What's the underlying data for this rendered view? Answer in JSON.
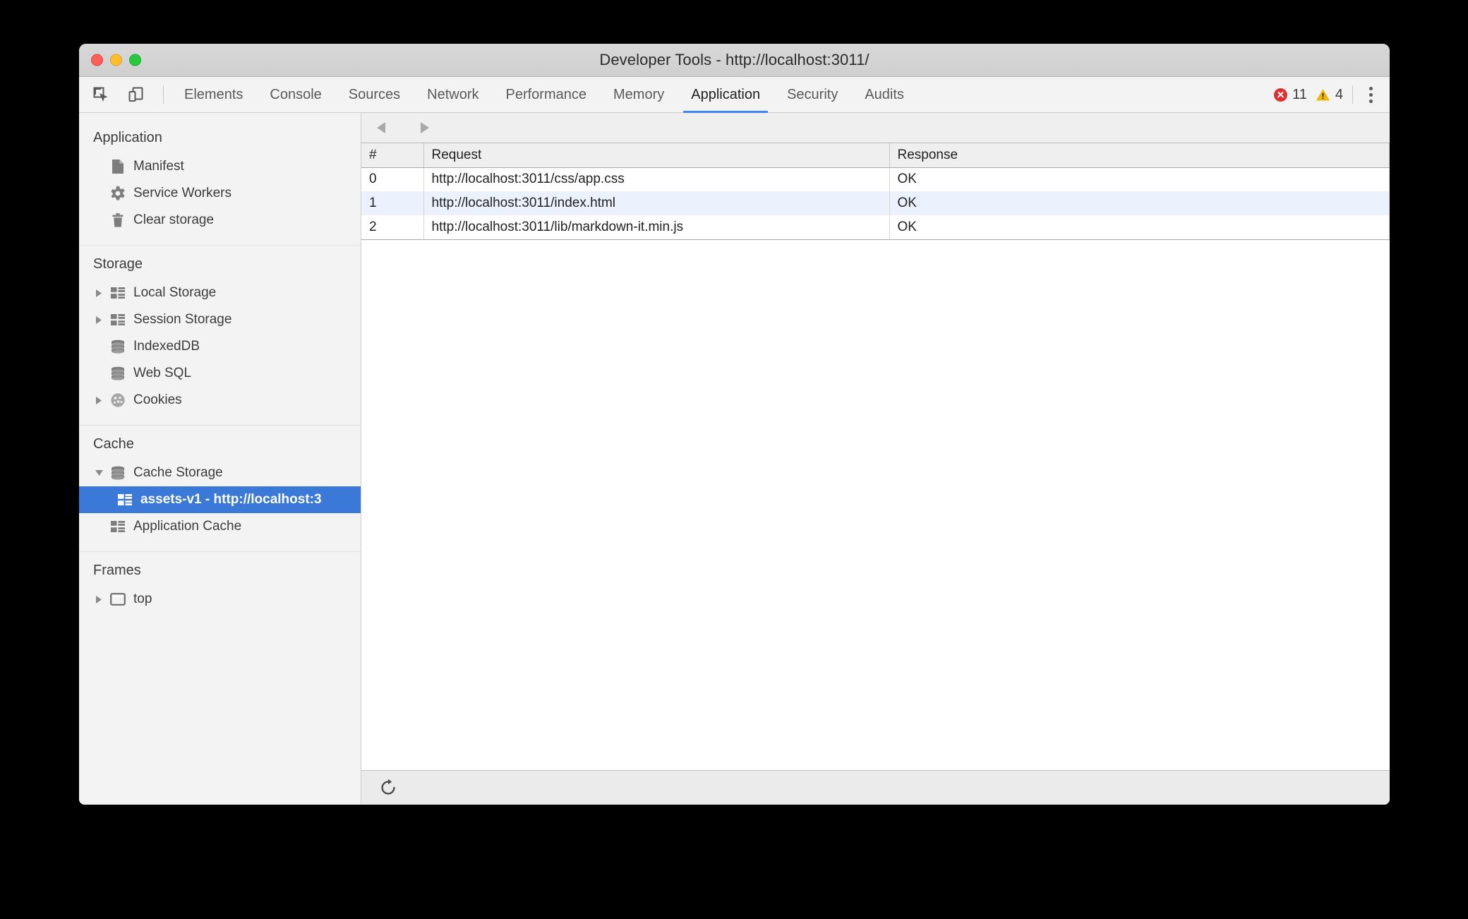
{
  "window": {
    "title": "Developer Tools - http://localhost:3011/",
    "traffic": {
      "close": "close-window",
      "minimize": "minimize-window",
      "maximize": "maximize-window"
    }
  },
  "toolbar": {
    "inspect_icon": "inspect-element-icon",
    "device_icon": "toggle-device-toolbar-icon",
    "tabs": [
      {
        "label": "Elements",
        "active": false
      },
      {
        "label": "Console",
        "active": false
      },
      {
        "label": "Sources",
        "active": false
      },
      {
        "label": "Network",
        "active": false
      },
      {
        "label": "Performance",
        "active": false
      },
      {
        "label": "Memory",
        "active": false
      },
      {
        "label": "Application",
        "active": true
      },
      {
        "label": "Security",
        "active": false
      },
      {
        "label": "Audits",
        "active": false
      }
    ],
    "error_count": "11",
    "warning_count": "4",
    "menu_icon": "more-options-icon",
    "accent": "#4285f4",
    "error_color": "#e02f2f",
    "warning_color": "#f2b600"
  },
  "sidebar": {
    "sections": [
      {
        "title": "Application",
        "items": [
          {
            "label": "Manifest",
            "icon": "manifest-document-icon",
            "indent": 1,
            "twisty": "none",
            "selected": false
          },
          {
            "label": "Service Workers",
            "icon": "gear-icon",
            "indent": 1,
            "twisty": "none",
            "selected": false
          },
          {
            "label": "Clear storage",
            "icon": "trash-icon",
            "indent": 1,
            "twisty": "none",
            "selected": false
          }
        ]
      },
      {
        "title": "Storage",
        "items": [
          {
            "label": "Local Storage",
            "icon": "table-icon",
            "indent": 1,
            "twisty": "collapsed",
            "selected": false
          },
          {
            "label": "Session Storage",
            "icon": "table-icon",
            "indent": 1,
            "twisty": "collapsed",
            "selected": false
          },
          {
            "label": "IndexedDB",
            "icon": "database-icon",
            "indent": 1,
            "twisty": "none",
            "selected": false
          },
          {
            "label": "Web SQL",
            "icon": "database-icon",
            "indent": 1,
            "twisty": "none",
            "selected": false
          },
          {
            "label": "Cookies",
            "icon": "cookie-icon",
            "indent": 1,
            "twisty": "collapsed",
            "selected": false
          }
        ]
      },
      {
        "title": "Cache",
        "items": [
          {
            "label": "Cache Storage",
            "icon": "database-icon",
            "indent": 1,
            "twisty": "expanded",
            "selected": false
          },
          {
            "label": "assets-v1 - http://localhost:3",
            "icon": "table-icon",
            "indent": 2,
            "twisty": "none",
            "selected": true
          },
          {
            "label": "Application Cache",
            "icon": "table-icon",
            "indent": 1,
            "twisty": "none",
            "selected": false
          }
        ]
      },
      {
        "title": "Frames",
        "items": [
          {
            "label": "top",
            "icon": "frame-icon",
            "indent": 1,
            "twisty": "collapsed",
            "selected": false
          }
        ]
      }
    ],
    "selection_color": "#3b79d8"
  },
  "content": {
    "nav_back_icon": "navigate-back-icon",
    "nav_forward_icon": "navigate-forward-icon",
    "refresh_icon": "refresh-icon",
    "table": {
      "columns": [
        "#",
        "Request",
        "Response"
      ],
      "rows": [
        {
          "num": "0",
          "request": "http://localhost:3011/css/app.css",
          "response": "OK"
        },
        {
          "num": "1",
          "request": "http://localhost:3011/index.html",
          "response": "OK"
        },
        {
          "num": "2",
          "request": "http://localhost:3011/lib/markdown-it.min.js",
          "response": "OK"
        }
      ]
    }
  }
}
